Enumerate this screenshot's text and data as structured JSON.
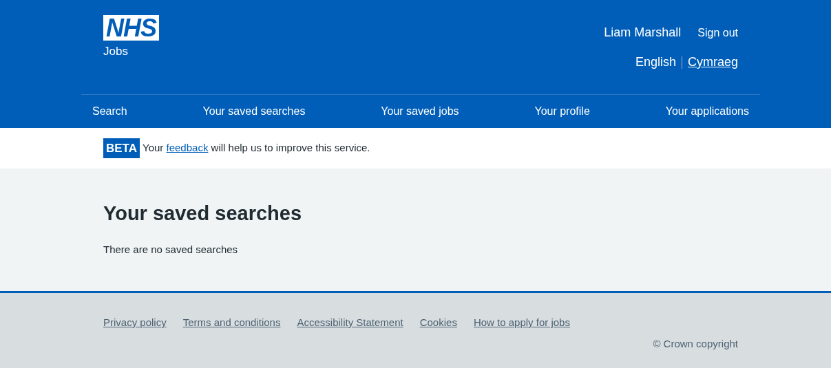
{
  "header": {
    "logo": "NHS",
    "service": "Jobs",
    "user": "Liam Marshall",
    "sign_out": "Sign out",
    "languages": [
      {
        "label": "English",
        "selected": true
      },
      {
        "label": "Cymraeg",
        "selected": false
      }
    ]
  },
  "nav": [
    "Search",
    "Your saved searches",
    "Your saved jobs",
    "Your profile",
    "Your applications"
  ],
  "banner": {
    "tag": "BETA",
    "text_before": "Your",
    "link": "feedback",
    "text_after": "will help us to improve this service."
  },
  "main": {
    "title": "Your saved searches",
    "message": "There are no saved searches"
  },
  "footer": {
    "links": [
      "Privacy policy",
      "Terms and conditions",
      "Accessibility Statement",
      "Cookies",
      "How to apply for jobs"
    ],
    "copyright": "© Crown copyright"
  }
}
